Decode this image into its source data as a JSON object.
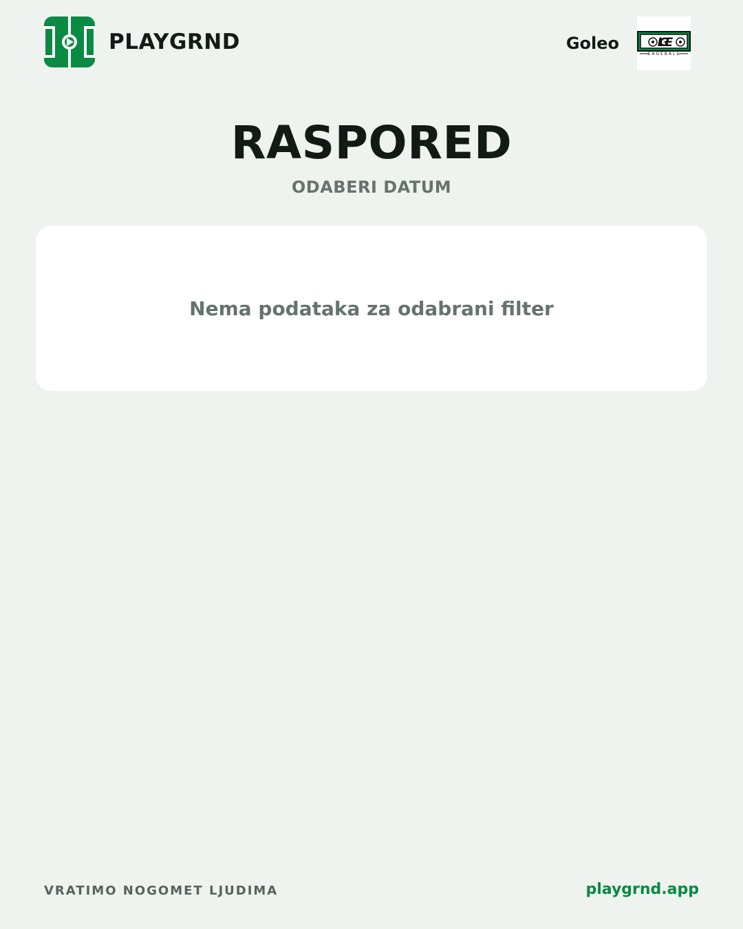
{
  "header": {
    "brand_name": "PLAYGRND",
    "brand_logo_icon": "football-pitch-icon",
    "partner_name": "Goleo",
    "partner_logo_icon": "goleo-cageball-logo"
  },
  "main": {
    "title": "RASPORED",
    "subtitle": "ODABERI DATUM",
    "empty_message": "Nema podataka za odabrani filter"
  },
  "footer": {
    "tagline": "VRATIMO NOGOMET LJUDIMA",
    "link": "playgrnd.app"
  },
  "colors": {
    "background": "#eef3ef",
    "brand_green": "#0a8a43",
    "card": "#ffffff",
    "muted_text": "#66736d",
    "dark_text": "#121a16"
  },
  "logo_text": {
    "partner_wordmark": "GOLEO",
    "partner_tagline": "CAGEBALL"
  }
}
